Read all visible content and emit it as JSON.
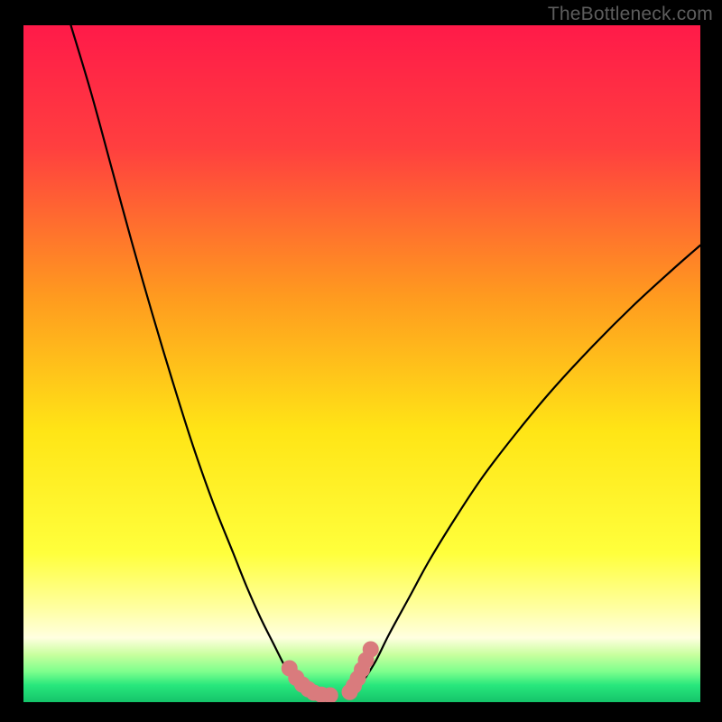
{
  "watermark": "TheBottleneck.com",
  "chart_data": {
    "type": "line",
    "title": "",
    "xlabel": "",
    "ylabel": "",
    "xlim": [
      0,
      100
    ],
    "ylim": [
      0,
      100
    ],
    "background_gradient": {
      "stops": [
        {
          "offset": 0.0,
          "color": "#ff1a49"
        },
        {
          "offset": 0.18,
          "color": "#ff3f3f"
        },
        {
          "offset": 0.4,
          "color": "#ff9a1f"
        },
        {
          "offset": 0.6,
          "color": "#ffe516"
        },
        {
          "offset": 0.78,
          "color": "#ffff3c"
        },
        {
          "offset": 0.86,
          "color": "#ffffa0"
        },
        {
          "offset": 0.905,
          "color": "#ffffe0"
        },
        {
          "offset": 0.93,
          "color": "#c8ff9e"
        },
        {
          "offset": 0.955,
          "color": "#7dff8d"
        },
        {
          "offset": 0.975,
          "color": "#28e77c"
        },
        {
          "offset": 1.0,
          "color": "#14c46a"
        }
      ]
    },
    "series": [
      {
        "name": "left-curve",
        "stroke": "#000000",
        "stroke_width": 2.2,
        "x": [
          7.0,
          10.0,
          13.0,
          16.0,
          19.0,
          22.0,
          25.0,
          28.0,
          31.0,
          33.0,
          35.0,
          37.0,
          38.5,
          40.0
        ],
        "y": [
          100.0,
          90.0,
          79.0,
          68.0,
          57.5,
          47.5,
          38.0,
          29.5,
          22.0,
          17.0,
          12.5,
          8.5,
          5.5,
          2.8
        ]
      },
      {
        "name": "right-curve",
        "stroke": "#000000",
        "stroke_width": 2.2,
        "x": [
          50.0,
          52.0,
          54.0,
          57.0,
          60.0,
          64.0,
          68.0,
          73.0,
          78.0,
          84.0,
          90.0,
          96.0,
          100.0
        ],
        "y": [
          2.8,
          6.0,
          10.0,
          15.5,
          21.0,
          27.5,
          33.5,
          40.0,
          46.0,
          52.5,
          58.5,
          64.0,
          67.5
        ]
      },
      {
        "name": "left-dot-trail",
        "type": "scatter",
        "marker_color": "#d97b7d",
        "marker_radius": 9,
        "x": [
          39.3,
          40.3,
          41.2,
          42.1,
          42.9,
          44.0,
          45.3
        ],
        "y": [
          5.0,
          3.6,
          2.6,
          1.9,
          1.4,
          1.1,
          1.0
        ]
      },
      {
        "name": "right-dot-trail",
        "type": "scatter",
        "marker_color": "#d97b7d",
        "marker_radius": 9,
        "x": [
          48.2,
          48.8,
          49.4,
          50.0,
          50.6,
          51.3
        ],
        "y": [
          1.5,
          2.4,
          3.5,
          4.8,
          6.2,
          7.8
        ]
      }
    ]
  }
}
